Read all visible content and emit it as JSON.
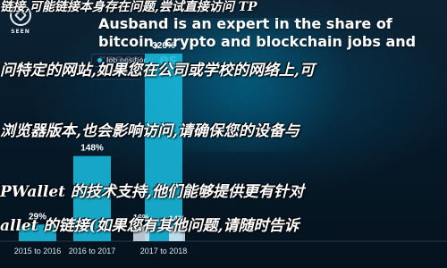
{
  "logo": {
    "text": "SEEN"
  },
  "headline": "Ausband is an expert in the share of bitcoin, crypto and blockchain jobs and resources",
  "legend": {
    "job_positions": "Job positions",
    "seekers": "Seekers"
  },
  "colors": {
    "bar": "#18b6d8",
    "dot_positions": "#27c4e6",
    "dot_seekers": "#e7eef4",
    "overlay_text": "#ffffff"
  },
  "chart_data": {
    "type": "bar",
    "categories": [
      "2015 to 2016",
      "2016 to 2017",
      "2017 to 2018"
    ],
    "series": [
      {
        "values": [
          29,
          148,
          326
        ]
      },
      {
        "values": [
          null,
          16,
          14
        ]
      }
    ],
    "data_labels": [
      "29%",
      "148%",
      "326%",
      "14%",
      "16%"
    ]
  },
  "overlay": {
    "line1": "链接,可能链接本身存在问题,尝试直接访问 TP",
    "line2": "问特定的网站,如果您在公司或学校的网络上,可",
    "line3": "浏览器版本,也会影响访问,请确保您的设备与",
    "line4": "PWallet 的技术支持,他们能够提供更有针对",
    "line5": "allet 的链接(如果您有其他问题,请随时告诉"
  }
}
